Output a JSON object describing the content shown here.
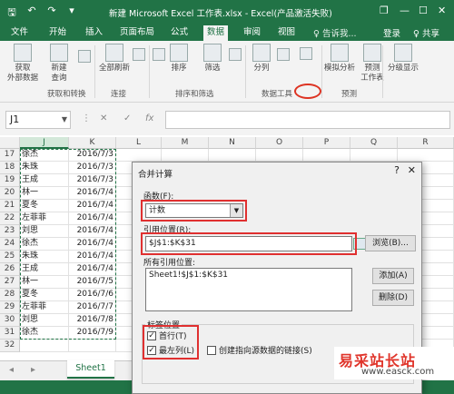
{
  "titlebar": {
    "title": "新建 Microsoft Excel 工作表.xlsx - Excel(产品激活失败)",
    "save": "🖫",
    "undo": "↶",
    "redo": "↷",
    "customize": "▾",
    "restore": "❐",
    "minimize": "—",
    "maximize": "☐",
    "close": "✕"
  },
  "tabs": {
    "file": "文件",
    "home": "开始",
    "insert": "插入",
    "layout": "页面布局",
    "formulas": "公式",
    "data": "数据",
    "review": "审阅",
    "view": "视图",
    "tell": "♀ 告诉我...",
    "login": "登录",
    "share": "♀ 共享"
  },
  "ribbon": {
    "get_external": "获取\n外部数据",
    "new_query": "新建\n查询",
    "refresh_all": "全部刷新",
    "sort": "排序",
    "filter": "筛选",
    "text_to_columns": "分列",
    "what_if": "模拟分析",
    "forecast": "预测\n工作表",
    "outline": "分级显示",
    "group_get": "获取和转换",
    "group_conn": "连接",
    "group_sort": "排序和筛选",
    "group_tools": "数据工具",
    "group_forecast": "预测"
  },
  "formula": {
    "namebox": "J1",
    "cancel": "✕",
    "confirm": "✓",
    "fx": "fx"
  },
  "sheet": {
    "columns": [
      "J",
      "K",
      "L",
      "M",
      "N",
      "O",
      "P",
      "Q",
      "R"
    ],
    "rows": [
      {
        "n": "17",
        "name": "徐杰",
        "date": "2016/7/3"
      },
      {
        "n": "18",
        "name": "朱珠",
        "date": "2016/7/3"
      },
      {
        "n": "19",
        "name": "王成",
        "date": "2016/7/3"
      },
      {
        "n": "20",
        "name": "林一",
        "date": "2016/7/4"
      },
      {
        "n": "21",
        "name": "夏冬",
        "date": "2016/7/4"
      },
      {
        "n": "22",
        "name": "左菲菲",
        "date": "2016/7/4"
      },
      {
        "n": "23",
        "name": "刘思",
        "date": "2016/7/4"
      },
      {
        "n": "24",
        "name": "徐杰",
        "date": "2016/7/4"
      },
      {
        "n": "25",
        "name": "朱珠",
        "date": "2016/7/4"
      },
      {
        "n": "26",
        "name": "王成",
        "date": "2016/7/4"
      },
      {
        "n": "27",
        "name": "林一",
        "date": "2016/7/5"
      },
      {
        "n": "28",
        "name": "夏冬",
        "date": "2016/7/6"
      },
      {
        "n": "29",
        "name": "左菲菲",
        "date": "2016/7/7"
      },
      {
        "n": "30",
        "name": "刘思",
        "date": "2016/7/8"
      },
      {
        "n": "31",
        "name": "徐杰",
        "date": "2016/7/9"
      },
      {
        "n": "32",
        "name": "",
        "date": ""
      }
    ],
    "sheet_tab": "Sheet1",
    "nav_prev": "◂",
    "nav_next": "▸"
  },
  "dialog": {
    "title": "合并计算",
    "help": "?",
    "close": "✕",
    "function_label": "函数(F):",
    "function_value": "计数",
    "ref_label": "引用位置(R):",
    "ref_value": "$J$1:$K$31",
    "browse": "浏览(B)...",
    "all_refs_label": "所有引用位置:",
    "all_refs_item": "Sheet1!$J$1:$K$31",
    "add": "添加(A)",
    "delete": "删除(D)",
    "label_group": "标签位置",
    "top_row": "首行(T)",
    "left_col": "最左列(L)",
    "create_links": "创建指向源数据的链接(S)",
    "check": "✓"
  },
  "watermark": {
    "brand": "易采站长站",
    "url": "www.easck.com"
  },
  "colors": {
    "excel_green": "#217346",
    "highlight_red": "#e03030"
  }
}
